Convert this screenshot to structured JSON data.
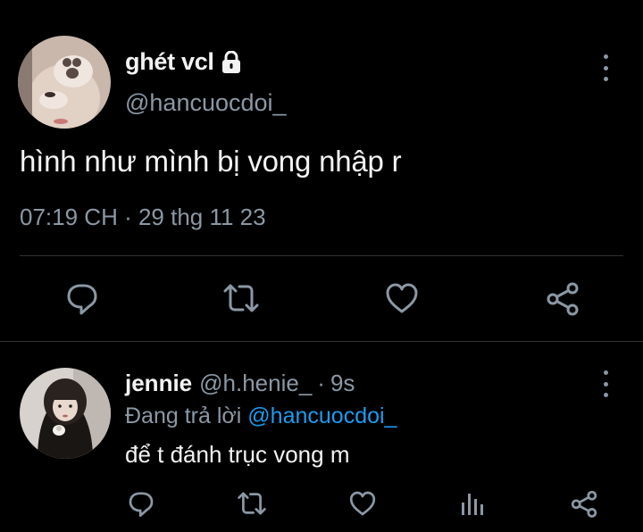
{
  "tweet": {
    "display_name": "ghét vcl",
    "handle": "@hancuocdoi_",
    "text": "hình như mình bị vong nhập r",
    "timestamp": "07:19 CH · 29 thg 11 23",
    "protected_icon": "lock-icon",
    "actions": [
      "reply-icon",
      "retweet-icon",
      "like-icon",
      "share-icon"
    ]
  },
  "reply": {
    "display_name": "jennie",
    "handle": "@h.henie_",
    "separator": "·",
    "age": "9s",
    "replying_prefix": "Đang trả lời",
    "replying_to": "@hancuocdoi_",
    "text": "để t đánh trục vong m",
    "actions": [
      "reply-icon",
      "retweet-icon",
      "like-icon",
      "analytics-icon",
      "share-icon"
    ]
  },
  "colors": {
    "background": "#000000",
    "text": "#e7e9ea",
    "muted": "#8b98a5",
    "accent": "#1d9bf0",
    "divider": "#2f3336"
  }
}
